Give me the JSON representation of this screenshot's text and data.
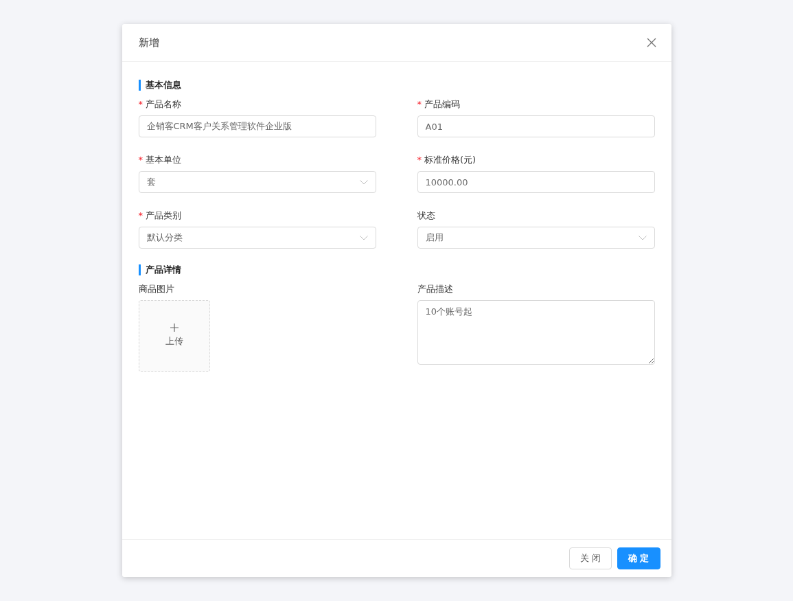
{
  "dialog": {
    "title": "新增"
  },
  "sections": [
    {
      "title": "基本信息",
      "fields": [
        {
          "kind": "input",
          "label": "产品名称",
          "required": true,
          "value": "企销客CRM客户关系管理软件企业版"
        },
        {
          "kind": "input",
          "label": "产品编码",
          "required": true,
          "value": "A01"
        },
        {
          "kind": "select",
          "label": "基本单位",
          "required": true,
          "value": "套"
        },
        {
          "kind": "input",
          "label": "标准价格(元)",
          "required": true,
          "value": "10000.00"
        },
        {
          "kind": "select",
          "label": "产品类别",
          "required": true,
          "value": "默认分类"
        },
        {
          "kind": "select",
          "label": "状态",
          "required": false,
          "value": "启用"
        }
      ]
    },
    {
      "title": "产品详情",
      "fields": [
        {
          "kind": "upload",
          "label": "商品图片",
          "required": false,
          "value": "上传"
        },
        {
          "kind": "textarea",
          "label": "产品描述",
          "required": false,
          "value": "10个账号起"
        }
      ]
    }
  ],
  "required_mark": "*",
  "buttons": [
    {
      "label": "关 闭",
      "primary": false
    },
    {
      "label": "确 定",
      "primary": true
    }
  ]
}
